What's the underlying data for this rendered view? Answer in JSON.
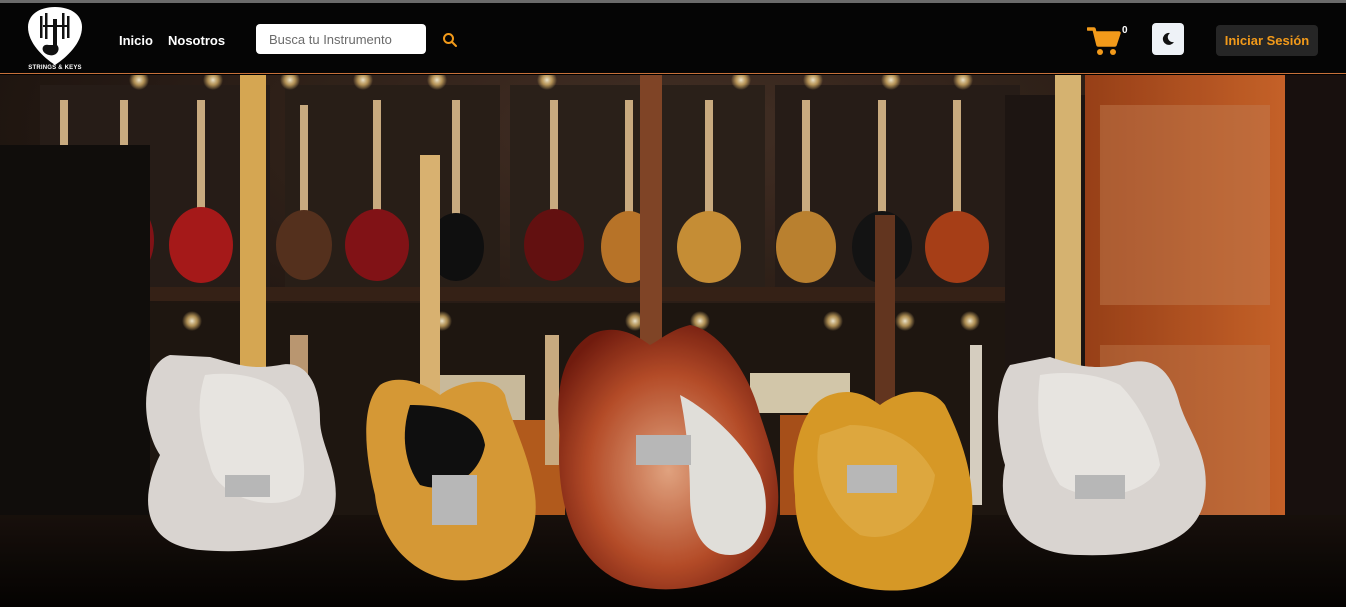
{
  "brand": {
    "logo_text": "STRINGS & KEYS",
    "logo_icon": "guitar-pick-icon"
  },
  "nav": {
    "links": [
      {
        "label": "Inicio"
      },
      {
        "label": "Nosotros"
      }
    ]
  },
  "search": {
    "placeholder": "Busca tu Instrumento",
    "icon": "search-icon"
  },
  "cart": {
    "icon": "shopping-cart-icon",
    "count": "0"
  },
  "theme_toggle": {
    "icon": "moon-icon"
  },
  "login": {
    "label": "Iniciar Sesión"
  },
  "hero": {
    "image": "guitar-store-photo"
  },
  "colors": {
    "accent": "#f29a1a",
    "navbar": "#050505",
    "divider": "#c7713a"
  }
}
